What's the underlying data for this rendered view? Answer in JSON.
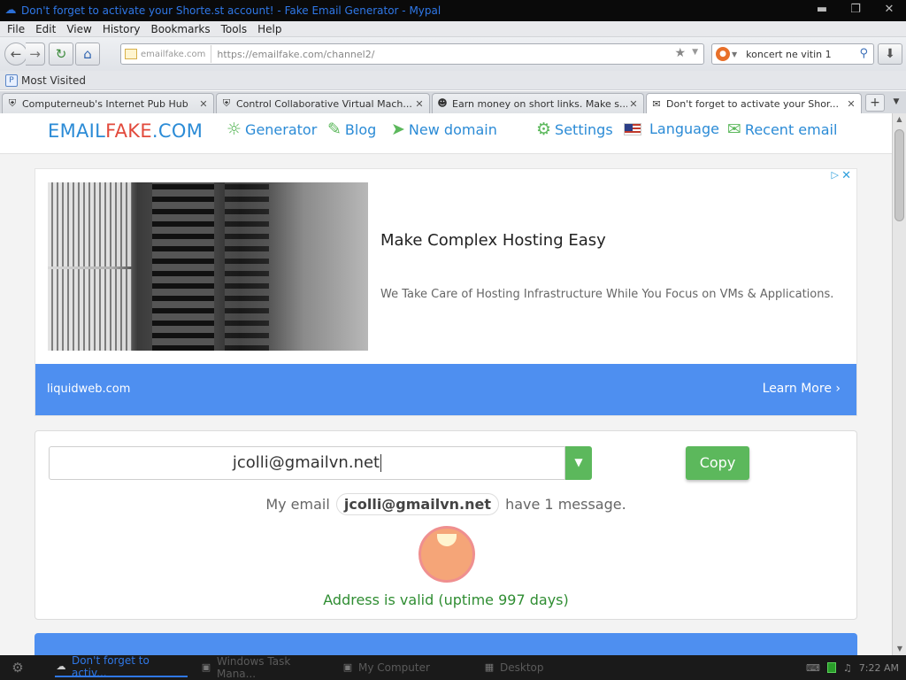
{
  "window": {
    "title": "Don't forget to activate your Shorte.st account! - Fake Email Generator - Mypal",
    "buttons": [
      "minimize",
      "maximize",
      "close"
    ]
  },
  "menu": [
    "File",
    "Edit",
    "View",
    "History",
    "Bookmarks",
    "Tools",
    "Help"
  ],
  "navbar": {
    "site_identity": "emailfake.com",
    "url": "https://emailfake.com/channel2/",
    "search_query": "koncert ne vitin 1"
  },
  "bookmarks": {
    "label": "Most Visited"
  },
  "tabs": [
    {
      "label": "Computerneub's Internet Pub Hub",
      "icon": "shield-icon",
      "active": false
    },
    {
      "label": "Control Collaborative Virtual Mach...",
      "icon": "shield-icon",
      "active": false
    },
    {
      "label": "Earn money on short links. Make s...",
      "icon": "avatar-icon",
      "active": false
    },
    {
      "label": "Don't forget to activate your Shor...",
      "icon": "envelope-icon",
      "active": true
    }
  ],
  "site": {
    "logo_a": "EMAIL",
    "logo_b": "FAKE",
    "logo_c": ".COM",
    "nav": {
      "generator": "Generator",
      "blog": "Blog",
      "new_domain": "New domain",
      "settings": "Settings",
      "language": "Language",
      "recent": "Recent email"
    }
  },
  "ad": {
    "title": "Make Complex Hosting Easy",
    "subtitle": "We Take Care of Hosting Infrastructure While You Focus on VMs & Applications.",
    "domain": "liquidweb.com",
    "cta": "Learn More"
  },
  "email_box": {
    "address": "jcolli@gmailvn.net",
    "copy_label": "Copy",
    "msg_prefix": "My email",
    "msg_email": "jcolli@gmailvn.net",
    "msg_suffix": "have 1 message.",
    "status": "Address is valid (uptime 997 days)"
  },
  "taskbar": {
    "tasks": [
      {
        "label": "Don't forget to activ...",
        "active": true
      },
      {
        "label": "Windows Task Mana...",
        "active": false
      },
      {
        "label": "My Computer",
        "active": false
      },
      {
        "label": "Desktop",
        "active": false
      }
    ],
    "clock": "7:22 AM"
  },
  "colors": {
    "accent_blue": "#2b8bd6",
    "logo_red": "#e24a3c",
    "green": "#5cb85c",
    "ad_footer": "#4e8ff0",
    "valid_green": "#2f8d32"
  }
}
